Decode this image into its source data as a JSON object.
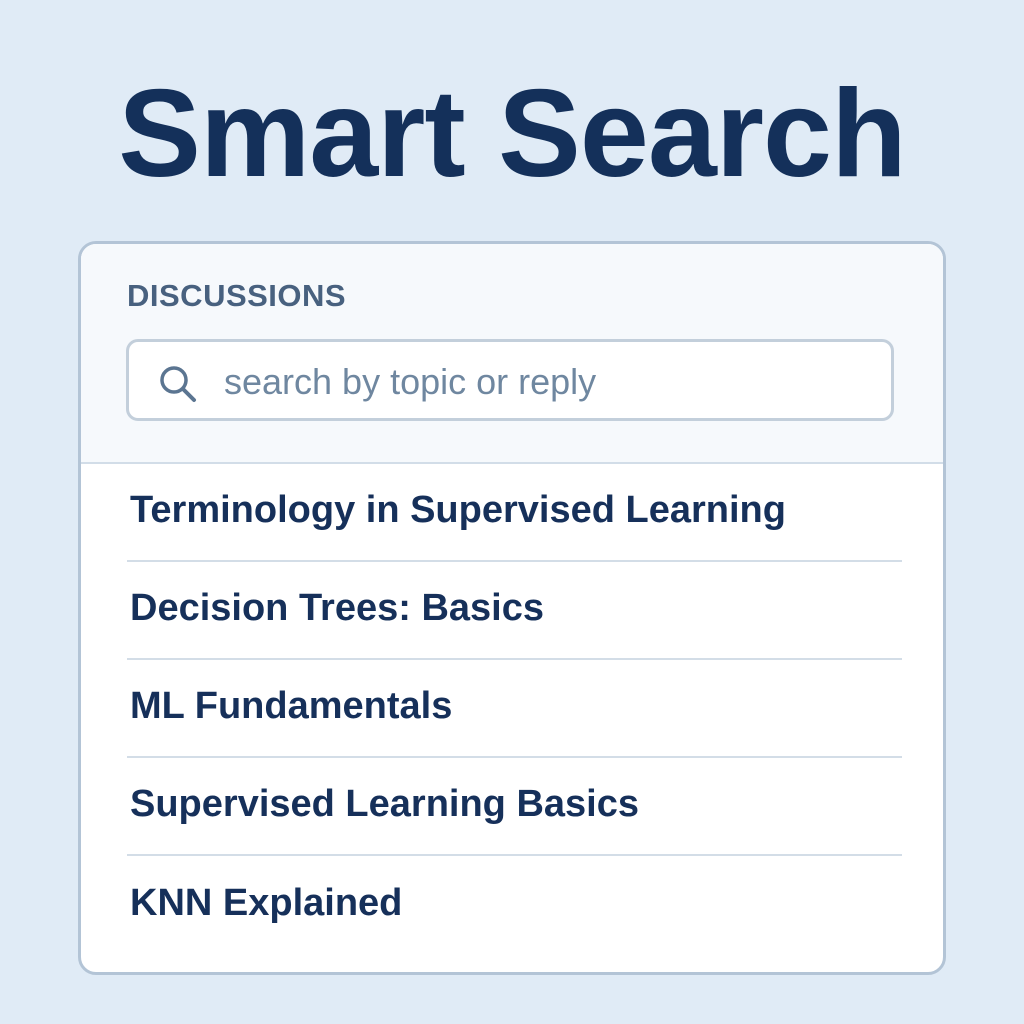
{
  "title": "Smart Search",
  "panel": {
    "label": "DISCUSSIONS",
    "search": {
      "placeholder": "search by topic or reply",
      "value": "",
      "icon": "search-icon"
    },
    "items": [
      {
        "label": "Terminology in Supervised Learning"
      },
      {
        "label": "Decision Trees: Basics"
      },
      {
        "label": "ML Fundamentals"
      },
      {
        "label": "Supervised Learning Basics"
      },
      {
        "label": "KNN Explained"
      }
    ]
  },
  "colors": {
    "background": "#e0ebf6",
    "title": "#14305a",
    "label": "#48617f",
    "border": "#b3c4d6"
  }
}
